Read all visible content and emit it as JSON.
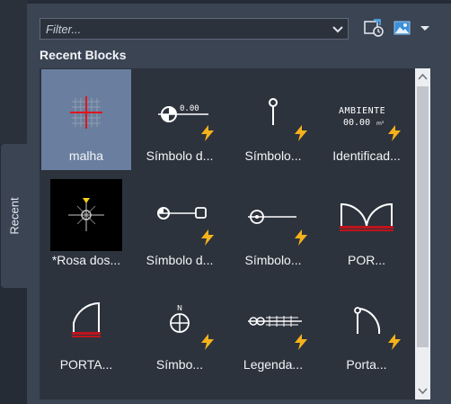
{
  "sidebar": {
    "tab_label": "Recent"
  },
  "toolbar": {
    "filter_placeholder": "Filter...",
    "icons": [
      "chevron-down-icon",
      "sync-clock-icon",
      "image-view-icon",
      "dropdown-caret-icon"
    ]
  },
  "section": {
    "title": "Recent Blocks"
  },
  "blocks": [
    {
      "label": "malha",
      "selected": true,
      "lightning": false,
      "icon": "grid-crosshair-icon"
    },
    {
      "label": "Símbolo d...",
      "selected": false,
      "lightning": true,
      "icon": "level-symbol-icon"
    },
    {
      "label": "Símbolo...",
      "selected": false,
      "lightning": true,
      "icon": "pin-symbol-icon"
    },
    {
      "label": "Identificad...",
      "selected": false,
      "lightning": true,
      "icon": "room-tag-icon"
    },
    {
      "label": "*Rosa dos...",
      "selected": false,
      "lightning": false,
      "icon": "compass-rose-icon"
    },
    {
      "label": "Símbolo d...",
      "selected": false,
      "lightning": true,
      "icon": "section-marker-icon"
    },
    {
      "label": "Símbolo...",
      "selected": false,
      "lightning": true,
      "icon": "target-line-icon"
    },
    {
      "label": "POR...",
      "selected": false,
      "lightning": false,
      "icon": "double-door-icon"
    },
    {
      "label": "PORTA...",
      "selected": false,
      "lightning": false,
      "icon": "single-door-icon"
    },
    {
      "label": "Símbo...",
      "selected": false,
      "lightning": true,
      "icon": "north-symbol-icon"
    },
    {
      "label": "Legenda...",
      "selected": false,
      "lightning": true,
      "icon": "legend-icon"
    },
    {
      "label": "Porta...",
      "selected": false,
      "lightning": true,
      "icon": "door-swing-icon"
    }
  ],
  "colors": {
    "panel_bg": "#3b4453",
    "grid_bg": "#2d333d",
    "selected_bg": "#6a7f9f",
    "lightning": "#f5b21b",
    "door_red": "#c0141c"
  }
}
